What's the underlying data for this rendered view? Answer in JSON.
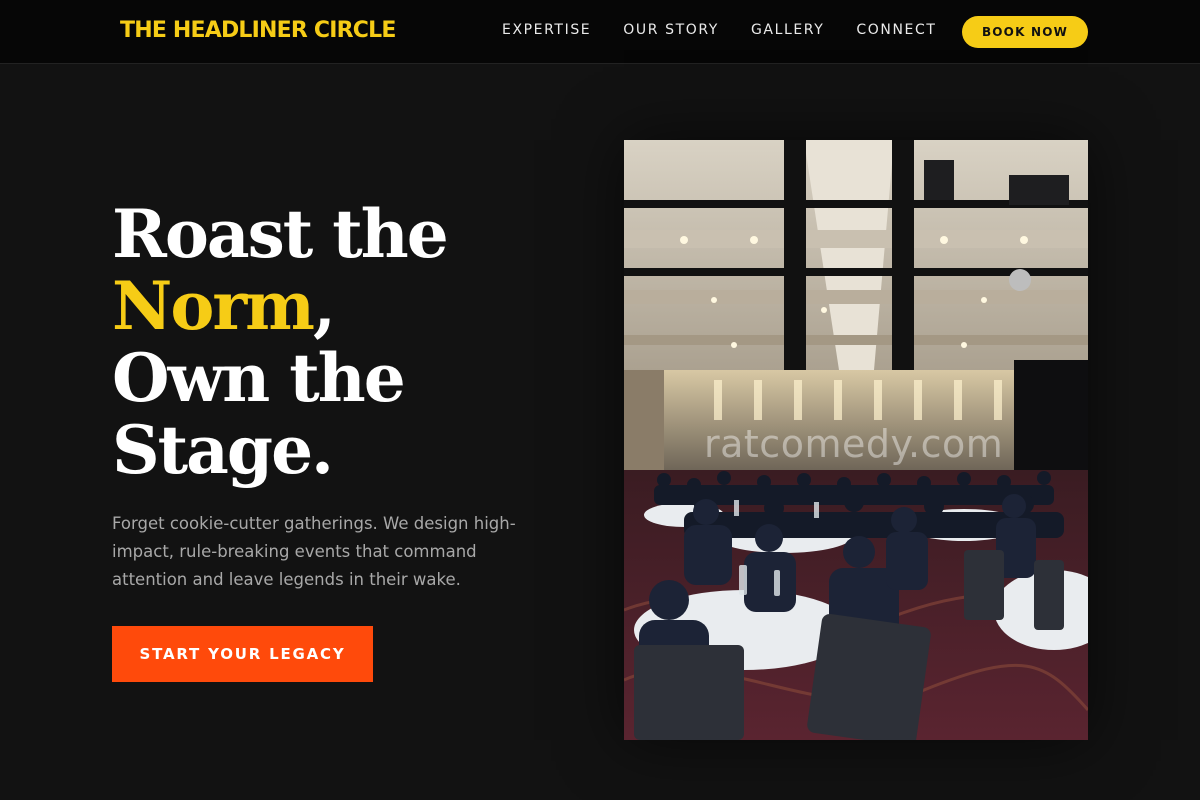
{
  "header": {
    "brand": "THE HEADLINER CIRCLE",
    "nav": [
      "EXPERTISE",
      "OUR STORY",
      "GALLERY",
      "CONNECT"
    ],
    "book_button": "BOOK NOW"
  },
  "hero": {
    "title_line1": "Roast the",
    "title_accent": "Norm",
    "title_comma": ",",
    "title_line3": "Own the",
    "title_line4": "Stage.",
    "description": "Forget cookie-cutter gatherings. We design high-impact, rule-breaking events that command attention and leave legends in their wake.",
    "cta": "START YOUR LEGACY"
  },
  "photo": {
    "watermark": "ratcomedy.com"
  },
  "colors": {
    "background": "#121212",
    "accent_yellow": "#f6cc16",
    "cta_orange": "#ff4a0b"
  }
}
